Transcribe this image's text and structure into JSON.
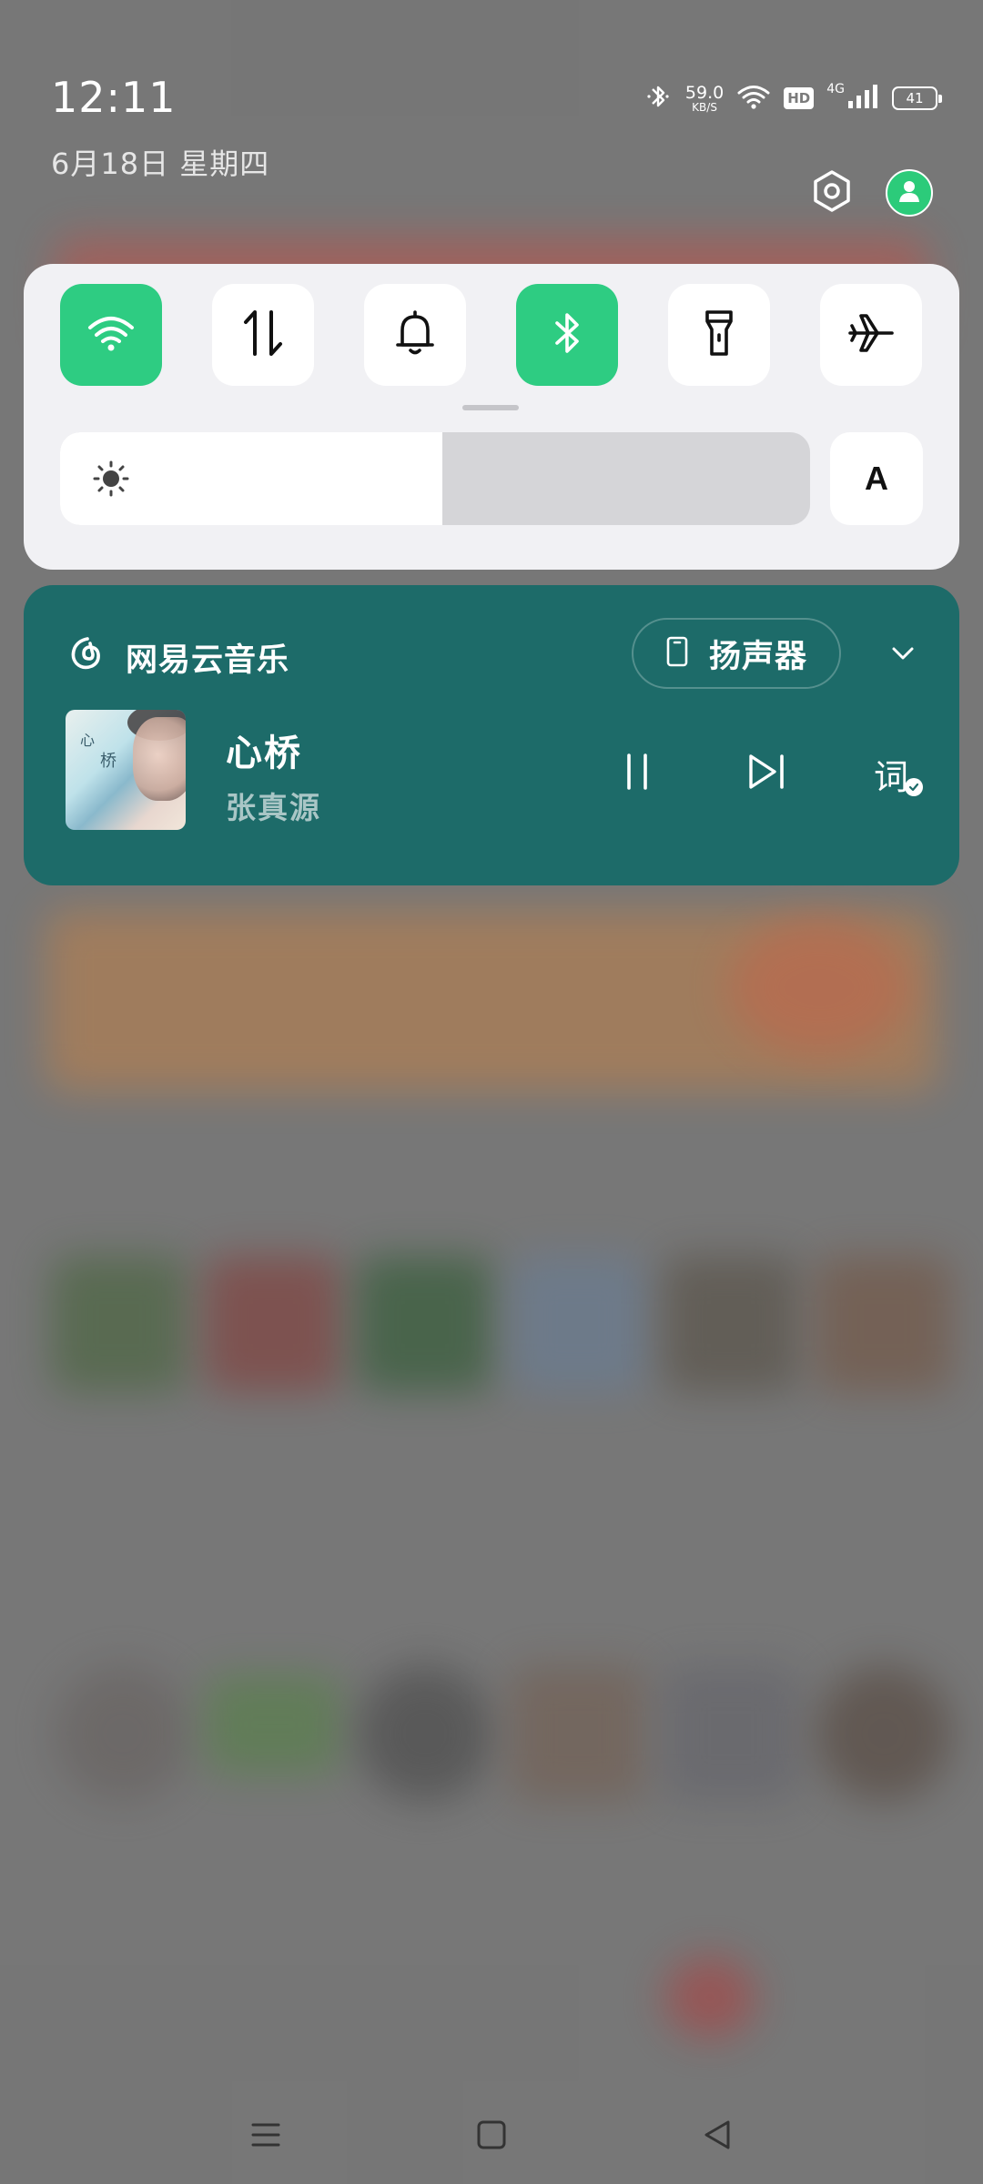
{
  "status_bar": {
    "time": "12:11",
    "date": "6月18日 星期四",
    "net_speed_value": "59.0",
    "net_speed_unit": "KB/S",
    "hd_label": "HD",
    "network_type": "4G",
    "battery_level": "41",
    "icons": [
      "bluetooth-icon",
      "wifi-icon",
      "hd-icon",
      "cellular-signal-icon",
      "battery-icon"
    ]
  },
  "top_actions": {
    "icons": [
      "settings-icon",
      "account-icon"
    ]
  },
  "quick_settings": {
    "tiles": [
      {
        "name": "wifi",
        "icon": "wifi-icon",
        "active": true
      },
      {
        "name": "mobile-data",
        "icon": "data-transfer-icon",
        "active": false
      },
      {
        "name": "sound",
        "icon": "bell-icon",
        "active": false
      },
      {
        "name": "bluetooth",
        "icon": "bluetooth-icon",
        "active": true
      },
      {
        "name": "flashlight",
        "icon": "flashlight-icon",
        "active": false
      },
      {
        "name": "airplane-mode",
        "icon": "airplane-icon",
        "active": false
      }
    ],
    "brightness": {
      "level": 0.51,
      "icon": "sun-icon"
    },
    "auto_brightness_label": "A"
  },
  "media": {
    "app_name": "网易云音乐",
    "app_icon": "netease-music-icon",
    "output_device": "扬声器",
    "output_icon": "phone-icon",
    "song_title": "心桥",
    "artist": "张真源",
    "album_art_text_1": "心",
    "album_art_text_2": "桥",
    "lyrics_label": "词",
    "controls": [
      "pause-icon",
      "next-track-icon",
      "lyrics-icon",
      "chevron-down-icon"
    ]
  },
  "colors": {
    "tile_active": "#2ecc82",
    "media_card": "#1d6b69",
    "panel": "#f1f1f4"
  },
  "navigation_bar": {
    "icons": [
      "menu-icon",
      "home-icon",
      "back-icon"
    ]
  }
}
